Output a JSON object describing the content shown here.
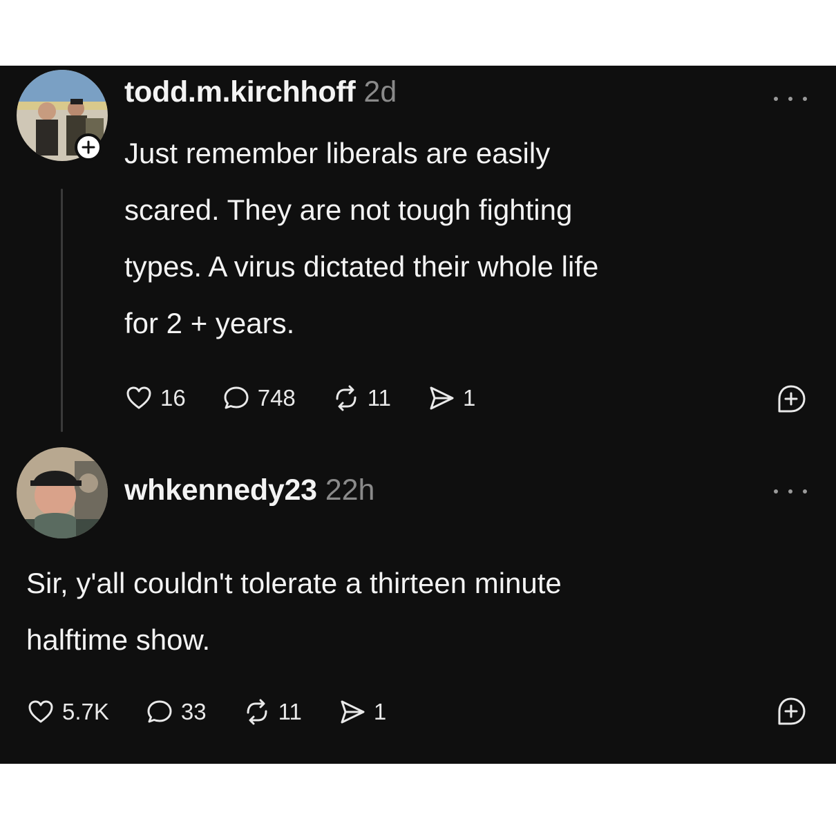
{
  "posts": [
    {
      "username": "todd.m.kirchhoff",
      "time": "2d",
      "lines": [
        "Just remember liberals are easily",
        "scared. They are not tough fighting",
        "types. A virus dictated their whole life",
        "for 2 + years."
      ],
      "likes": "16",
      "replies": "748",
      "reposts": "11",
      "shares": "1"
    },
    {
      "username": "whkennedy23",
      "time": "22h",
      "lines": [
        "Sir, y'all couldn't tolerate a thirteen minute",
        "halftime show."
      ],
      "likes": "5.7K",
      "replies": "33",
      "reposts": "11",
      "shares": "1"
    }
  ],
  "icons": {
    "like": "heart-icon",
    "reply": "speech-bubble-icon",
    "repost": "repost-icon",
    "share": "send-icon",
    "follow": "plus-icon",
    "more": "more-dots-icon",
    "save": "add-comment-icon"
  },
  "colors": {
    "background": "#0f0f0f",
    "text": "#f3f3f3",
    "muted": "#8a8a8a"
  }
}
